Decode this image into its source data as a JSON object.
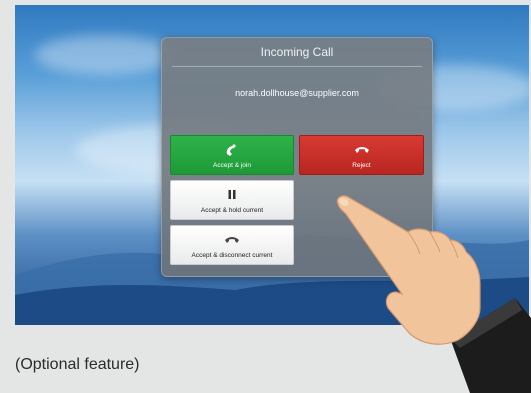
{
  "dialog": {
    "title": "Incoming Call",
    "caller": "norah.dollhouse@supplier.com"
  },
  "buttons": {
    "accept_join": "Accept & join",
    "reject": "Reject",
    "accept_hold": "Accept & hold current",
    "accept_disconnect": "Accept & disconnect current"
  },
  "caption": "(Optional feature)",
  "colors": {
    "accept": "#22a33d",
    "reject": "#c9302a",
    "neutral": "#f2f2f2"
  },
  "icons": {
    "accept": "phone-answer-icon",
    "reject": "phone-hangup-icon",
    "hold": "pause-icon",
    "disconnect": "phone-hangup-icon"
  }
}
